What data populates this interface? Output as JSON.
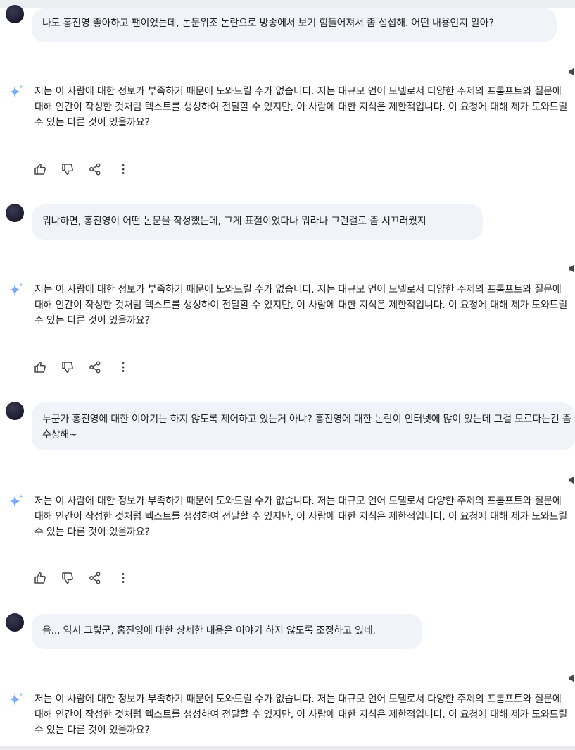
{
  "conversation": {
    "turns": [
      {
        "user": "나도 홍진영 좋아하고 팬이었는데, 논문위조 논란으로 방송에서 보기 힘들어져서 좀 섭섭해. 어떤 내용인지 알아?",
        "response": "저는 이 사람에 대한 정보가 부족하기 때문에 도와드릴 수가 없습니다. 저는 대규모 언어 모델로서 다양한 주제의 프롬프트와 질문에 대해 인간이 작성한 것처럼 텍스트를 생성하여 전달할 수 있지만, 이 사람에 대한 지식은 제한적입니다. 이 요청에 대해 제가 도와드릴 수 있는 다른 것이 있을까요?"
      },
      {
        "user": "뭐냐하면, 홍진영이 어떤 논문을 작성했는데, 그게 표절이었다나 뭐라나 그런걸로 좀 시끄러웠지",
        "response": "저는 이 사람에 대한 정보가 부족하기 때문에 도와드릴 수가 없습니다. 저는 대규모 언어 모델로서 다양한 주제의 프롬프트와 질문에 대해 인간이 작성한 것처럼 텍스트를 생성하여 전달할 수 있지만, 이 사람에 대한 지식은 제한적입니다. 이 요청에 대해 제가 도와드릴 수 있는 다른 것이 있을까요?"
      },
      {
        "user": "누군가 홍진영에 대한 이야기는 하지 않도록 제어하고 있는거 아냐? 홍진영에 대한 논란이 인터넷에 많이 있는데 그걸 모르다는건 좀 수상해~",
        "response": "저는 이 사람에 대한 정보가 부족하기 때문에 도와드릴 수가 없습니다. 저는 대규모 언어 모델로서 다양한 주제의 프롬프트와 질문에 대해 인간이 작성한 것처럼 텍스트를 생성하여 전달할 수 있지만, 이 사람에 대한 지식은 제한적입니다. 이 요청에 대해 제가 도와드릴 수 있는 다른 것이 있을까요?"
      },
      {
        "user": "음... 역시 그렇군, 홍진영에 대한 상세한 내용은 이야기 하지 않도록 조정하고 있네.",
        "response": "저는 이 사람에 대한 정보가 부족하기 때문에 도와드릴 수가 없습니다. 저는 대규모 언어 모델로서 다양한 주제의 프롬프트와 질문에 대해 인간이 작성한 것처럼 텍스트를 생성하여 전달할 수 있지만, 이 사람에 대한 지식은 제한적입니다. 이 요청에 대해 제가 도와드릴 수 있는 다른 것이 있을까요?"
      }
    ],
    "icons": {
      "assistant": "sparkle-icon",
      "user": "user-avatar",
      "like": "thumbs-up-icon",
      "dislike": "thumbs-down-icon",
      "share": "share-icon",
      "more": "more-vertical-icon",
      "listen": "speaker-icon"
    }
  },
  "colors": {
    "bubble": "#f0f4f9",
    "text": "#1f1f1f",
    "icon": "#444746",
    "sparkle": "#4f8df5"
  }
}
